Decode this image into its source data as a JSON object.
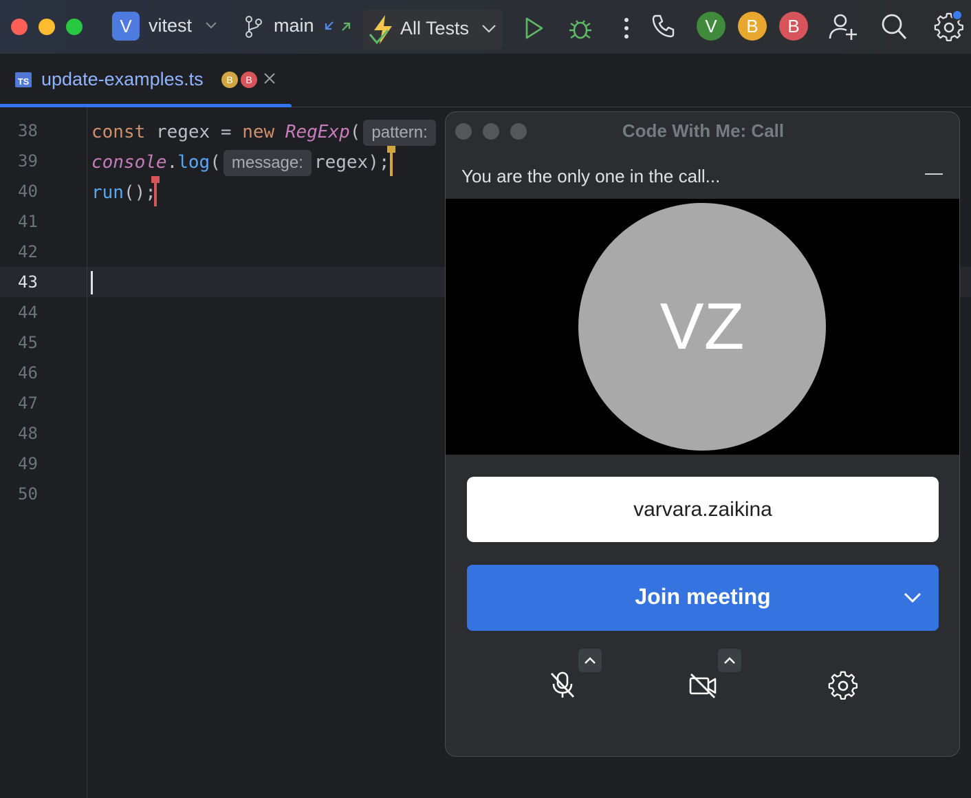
{
  "titlebar": {
    "project_badge": "V",
    "project_name": "vitest",
    "branch": "main",
    "run_config": "All Tests",
    "avatars": [
      "V",
      "B",
      "B"
    ]
  },
  "tab": {
    "file_type": "TS",
    "file_name": "update-examples.ts",
    "participants": [
      "B",
      "B"
    ]
  },
  "editor": {
    "line_numbers": [
      "38",
      "39",
      "40",
      "41",
      "42",
      "43",
      "44",
      "45",
      "46",
      "47",
      "48",
      "49",
      "50"
    ],
    "active_line": "43",
    "line38": {
      "kw": "const",
      "var": "regex",
      "eq": "=",
      "new": "new",
      "cls": "RegExp",
      "paren": "(",
      "hint": "pattern:"
    },
    "line39": {
      "obj": "console",
      "dot": ".",
      "fn": "log",
      "paren": "(",
      "hint": "message:",
      "arg": "regex);"
    },
    "line40": {
      "fn": "run",
      "rest": "();"
    }
  },
  "call": {
    "title": "Code With Me: Call",
    "status": "You are the only one in the call...",
    "initials": "VZ",
    "username": "varvara.zaikina",
    "join_label": "Join meeting"
  },
  "icons": {
    "branch": "branch-icon",
    "run": "run-icon",
    "debug": "debug-icon",
    "more": "more-vertical-icon",
    "call": "phone-icon",
    "add_user": "add-user-icon",
    "search": "search-icon",
    "settings": "gear-icon",
    "mic_off": "mic-off-icon",
    "camera_off": "camera-off-icon"
  },
  "colors": {
    "accent": "#3574f0",
    "join_button": "#3574e0",
    "tl_red": "#fe5f57",
    "tl_yellow": "#febc2e",
    "tl_green": "#28c840"
  }
}
